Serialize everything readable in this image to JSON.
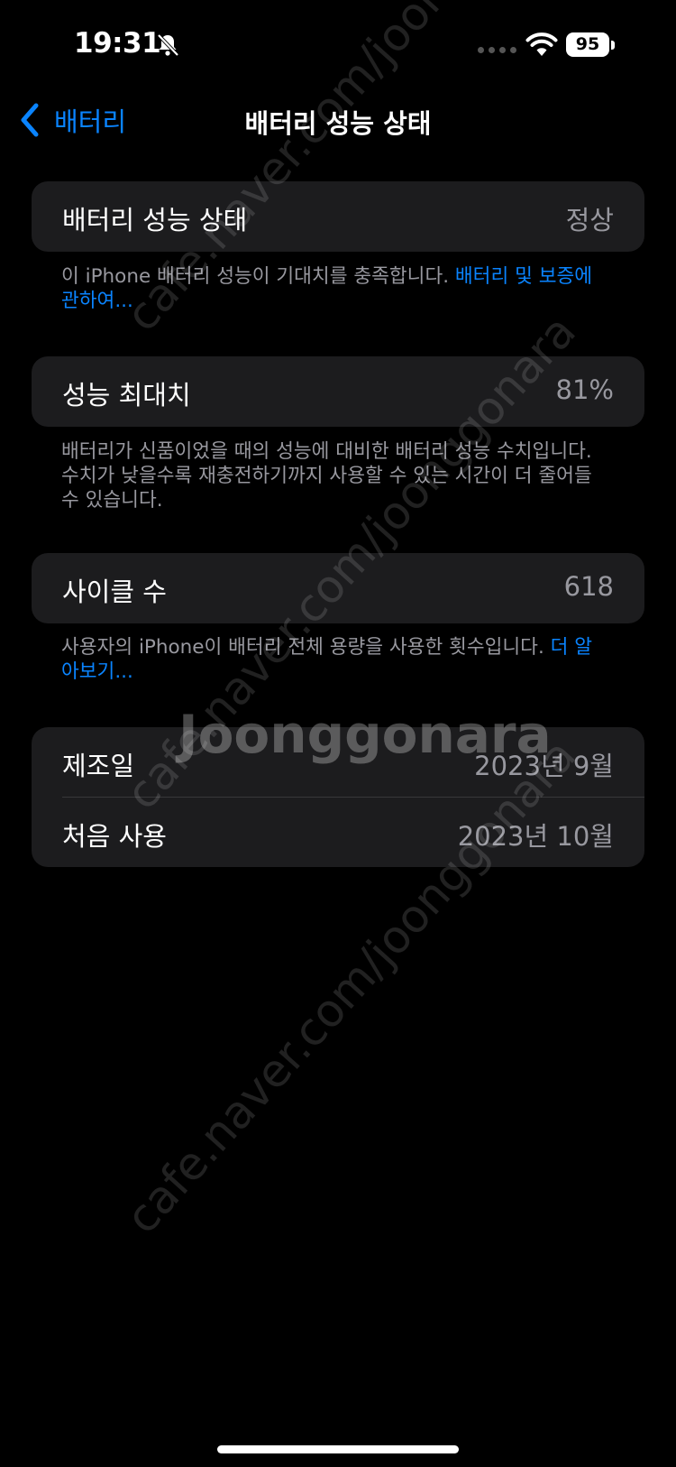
{
  "status_bar": {
    "time": "19:31",
    "battery_level": "95"
  },
  "nav": {
    "back_label": "배터리",
    "title": "배터리 성능 상태"
  },
  "health": {
    "label": "배터리 성능 상태",
    "value": "정상"
  },
  "health_note": {
    "text": "이 iPhone 배터리 성능이 기대치를 충족합니다. ",
    "link": "배터리 및 보증에 관하여..."
  },
  "max_capacity": {
    "label": "성능 최대치",
    "value": "81%"
  },
  "capacity_note": {
    "text": "배터리가 신품이었을 때의 성능에 대비한 배터리 성능 수치입니다. 수치가 낮을수록 재충전하기까지 사용할 수 있는 시간이 더 줄어들 수 있습니다."
  },
  "cycle": {
    "label": "사이클 수",
    "value": "618"
  },
  "cycle_note": {
    "text": "사용자의 iPhone이 배터리 전체 용량을 사용한 횟수입니다. ",
    "link": "더 알아보기..."
  },
  "dates": {
    "manufacture": {
      "label": "제조일",
      "value": "2023년 9월"
    },
    "first_use": {
      "label": "처음 사용",
      "value": "2023년 10월"
    }
  },
  "watermark": {
    "url": "cafe.naver.com/joonggonara",
    "logo": "Joonggonara"
  }
}
